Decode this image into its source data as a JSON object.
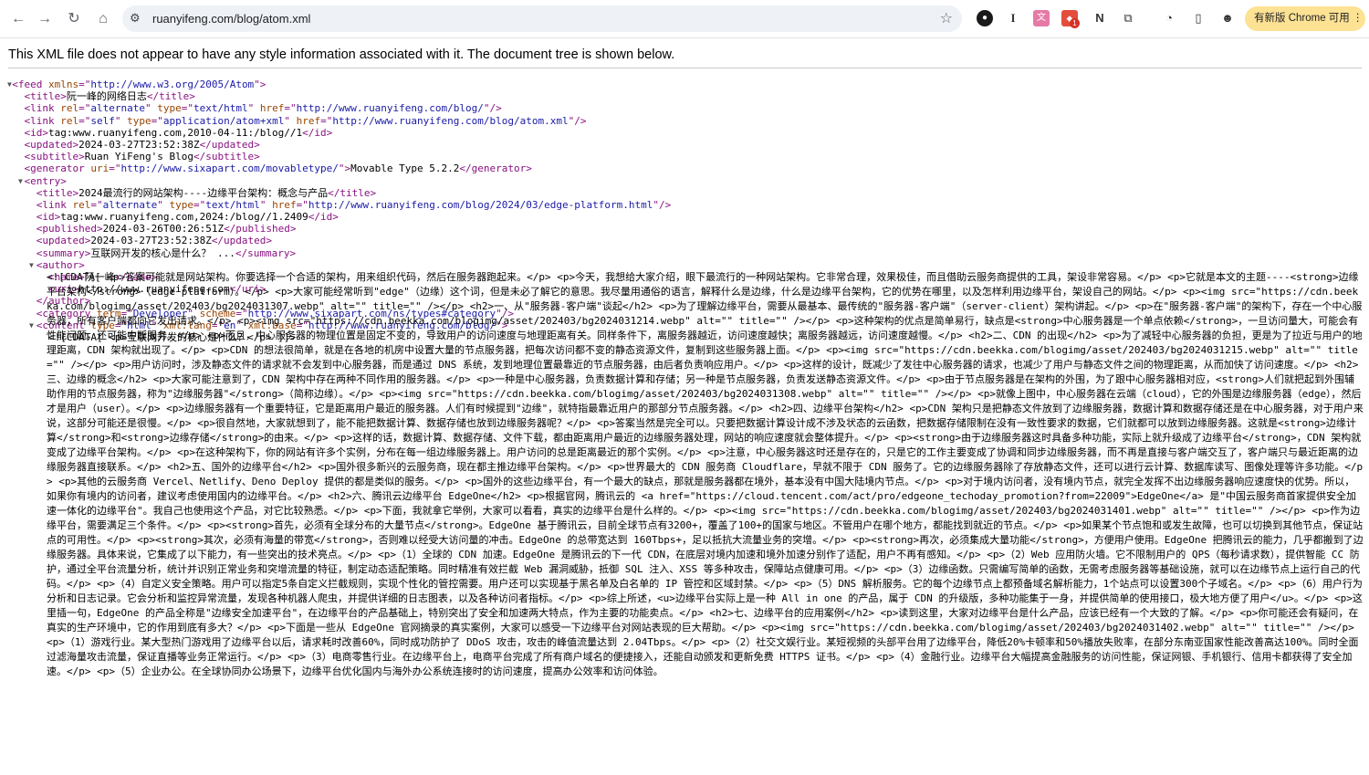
{
  "browser": {
    "url": "ruanyifeng.com/blog/atom.xml",
    "update_label": "有新版 Chrome 可用",
    "ext_badge": "1"
  },
  "banner": "This XML file does not appear to have any style information associated with it. The document tree is shown below.",
  "xml": {
    "feed_open": "<feed xmlns=\"http://www.w3.org/2005/Atom\">",
    "title": "阮一峰的网络日志",
    "link_alt_href": "http://www.ruanyifeng.com/blog/",
    "link_self_href": "http://www.ruanyifeng.com/blog/atom.xml",
    "id": "tag:www.ruanyifeng.com,2010-04-11:/blog//1",
    "updated": "2024-03-27T23:52:38Z",
    "subtitle": "Ruan YiFeng's Blog",
    "generator_uri": "http://www.sixapart.com/movabletype/",
    "generator": "Movable Type 5.2.2",
    "entry": {
      "title": "2024最流行的网站架构----边缘平台架构：概念与产品",
      "link_href": "http://www.ruanyifeng.com/blog/2024/03/edge-platform.html",
      "id": "tag:www.ruanyifeng.com,2024:/blog//1.2409",
      "published": "2024-03-26T00:26:51Z",
      "updated": "2024-03-27T23:52:38Z",
      "summary": "互联网开发的核心是什么？ ...",
      "author_name": "阮一峰",
      "author_uri": "http://www.ruanyifeng.com",
      "category_term": "Developer",
      "category_scheme": "http://www.sixapart.com/ns/types#category",
      "content_base": "http://www.ruanyifeng.com/blog/",
      "cdata_short": "<![CDATA[ <p>互联网开发的核心是什么？</p> ]]>",
      "cdata_long": "<![CDATA[ <p>答案可能就是网站架构。你要选择一个合适的架构，用来组织代码，然后在服务器跑起来。</p> <p>今天，我想给大家介绍，眼下最流行的一种网站架构。它非常合理，效果极佳，而且借助云服务商提供的工具，架设非常容易。</p> <p>它就是本文的主题----<strong>边缘平台架构</strong>（edge platform）。</p> <p>大家可能经常听到\"edge\"（边缘）这个词，但是未必了解它的意思。我尽量用通俗的语言，解释什么是边缘，什么是边缘平台架构，它的优势在哪里，以及怎样利用边缘平台，架设自己的网站。</p> <p><img src=\"https://cdn.beekka.com/blogimg/asset/202403/bg2024031307.webp\" alt=\"\" title=\"\" /></p> <h2>一、从\"服务器-客户端\"谈起</h2> <p>为了理解边缘平台，需要从最基本、最传统的\"服务器-客户端\"（server-client）架构讲起。</p> <p>在\"服务器-客户端\"的架构下，存在一个中心服务器，所有客户端都向它发出请求。</p> <p><img src=\"https://cdn.beekka.com/blogimg/asset/202403/bg2024031214.webp\" alt=\"\" title=\"\" /></p> <p>这种架构的优点是简单易行，缺点是<strong>中心服务器是一个单点依赖</strong>，一旦访问量大，可能会有性能问题，还可能中断服务。</p> <p>而且，中心服务器的物理位置是固定不变的，导致用户的访问速度与地理距离有关。同样条件下，离服务器越近，访问速度越快；离服务器越远，访问速度越慢。</p> <h2>二、CDN 的出现</h2> <p>为了减轻中心服务器的负担，更是为了拉近与用户的地理距离，CDN 架构就出现了。</p> <p>CDN 的想法很简单，就是在各地的机房中设置大量的节点服务器，把每次访问都不变的静态资源文件，复制到这些服务器上面。</p> <p><img src=\"https://cdn.beekka.com/blogimg/asset/202403/bg2024031215.webp\" alt=\"\" title=\"\" /></p> <p>用户访问时，涉及静态文件的请求就不会发到中心服务器，而是通过 DNS 系统，发到地理位置最靠近的节点服务器，由后者负责响应用户。</p> <p>这样的设计，既减少了发往中心服务器的请求，也减少了用户与静态文件之间的物理距离，从而加快了访问速度。</p> <h2>三、边缘的概念</h2> <p>大家可能注意到了，CDN 架构中存在两种不同作用的服务器。</p> <p>一种是中心服务器，负责数据计算和存储；另一种是节点服务器，负责发送静态资源文件。</p> <p>由于节点服务器是在架构的外围，为了跟中心服务器相对应，<strong>人们就把起到外围辅助作用的节点服务器，称为\"边缘服务器\"</strong>（简称边缘）。</p> <p><img src=\"https://cdn.beekka.com/blogimg/asset/202403/bg2024031308.webp\" alt=\"\" title=\"\" /></p> <p>就像上图中，中心服务器在云端（cloud），它的外围是边缘服务器（edge），然后才是用户（user）。</p> <p>边缘服务器有一个重要特征，它是距离用户最近的服务器。人们有时候提到\"边缘\"，就特指最靠近用户的那部分节点服务器。</p> <h2>四、边缘平台架构</h2> <p>CDN 架构只是把静态文件放到了边缘服务器，数据计算和数据存储还是在中心服务器，对于用户来说，这部分可能还是很慢。</p> <p>很自然地，大家就想到了，能不能把数据计算、数据存储也放到边缘服务器呢？</p> <p>答案当然是完全可以。只要把数据计算设计成不涉及状态的云函数，把数据存储限制在没有一致性要求的数据，它们就都可以放到边缘服务器。这就是<strong>边缘计算</strong>和<strong>边缘存储</strong>的由来。</p> <p>这样的话，数据计算、数据存储、文件下载，都由距离用户最近的边缘服务器处理，网站的响应速度就会整体提升。</p> <p><strong>由于边缘服务器这时具备多种功能，实际上就升级成了边缘平台</strong>，CDN 架构就变成了边缘平台架构。</p> <p>在这种架构下，你的网站有许多个实例，分布在每一组边缘服务器上。用户访问的总是距离最近的那个实例。</p> <p>注意，中心服务器这时还是存在的，只是它的工作主要变成了协调和同步边缘服务器，而不再是直接与客户端交互了，客户端只与最近距离的边缘服务器直接联系。</p> <h2>五、国外的边缘平台</h2> <p>国外很多新兴的云服务商，现在都主推边缘平台架构。</p> <p>世界最大的 CDN 服务商 Cloudflare，早就不限于 CDN 服务了。它的边缘服务器除了存放静态文件，还可以进行云计算、数据库读写、图像处理等许多功能。</p> <p>其他的云服务商 Vercel、Netlify、Deno Deploy 提供的都是类似的服务。</p> <p>国外的这些边缘平台，有一个最大的缺点，那就是服务器都在境外，基本没有中国大陆境内节点。</p> <p>对于境内访问者，没有境内节点，就完全发挥不出边缘服务器响应速度快的优势。所以，如果你有境内的访问者，建议考虑使用国内的边缘平台。</p> <h2>六、腾讯云边缘平台 EdgeOne</h2> <p>根据官网，腾讯云的 <a href=\"https://cloud.tencent.com/act/pro/edgeone_techoday_promotion?from=22009\">EdgeOne</a> 是\"中国云服务商首家提供安全加速一体化的边缘平台\"。我自己也使用这个产品，对它比较熟悉。</p> <p>下面，我就拿它举例，大家可以看看，真实的边缘平台是什么样的。</p> <p><img src=\"https://cdn.beekka.com/blogimg/asset/202403/bg2024031401.webp\" alt=\"\" title=\"\" /></p> <p>作为边缘平台，需要满足三个条件。</p> <p><strong>首先，必须有全球分布的大量节点</strong>。EdgeOne 基于腾讯云，目前全球节点有3200+，覆盖了100+的国家与地区。不管用户在哪个地方，都能找到就近的节点。</p> <p>如果某个节点饱和或发生故障，也可以切换到其他节点，保证站点的可用性。</p> <p><strong>其次，必须有海量的带宽</strong>，否则难以经受大访问量的冲击。EdgeOne 的总带宽达到 160Tbps+，足以抵抗大流量业务的突增。</p> <p><strong>再次，必须集成大量功能</strong>，方便用户使用。EdgeOne 把腾讯云的能力，几乎都搬到了边缘服务器。具体来说，它集成了以下能力，有一些突出的技术亮点。</p> <p>（1）全球的 CDN 加速。EdgeOne 是腾讯云的下一代 CDN，在底层对境内加速和境外加速分别作了适配，用户不再有感知。</p> <p>（2）Web 应用防火墙。它不限制用户的 QPS（每秒请求数），提供智能 CC 防护，通过全平台流量分析，统计并识别正常业务和突增流量的特征，制定动态适配策略。同时精准有效拦截 Web 漏洞威胁，抵御 SQL 注入、XSS 等多种攻击，保障站点健康可用。</p> <p>（3）边缘函数。只需编写简单的函数，无需考虑服务器等基础设施，就可以在边缘节点上运行自己的代码。</p> <p>（4）自定义安全策略。用户可以指定5条自定义拦截规则，实现个性化的管控需要。用户还可以实现基于黑名单及白名单的 IP 管控和区域封禁。</p> <p>（5）DNS 解析服务。它的每个边缘节点上都预备域名解析能力，1个站点可以设置300个子域名。</p> <p>（6）用户行为分析和日志记录。它会分析和监控异常流量，发现各种机器人爬虫，并提供详细的日志图表，以及各种访问者指标。</p> <p>综上所述，<u>边缘平台实际上是一种 All in one 的产品，属于 CDN 的升级版，多种功能集于一身，并提供简单的使用接口，极大地方便了用户</u>。</p> <p>这里插一句，EdgeOne 的产品全称是\"边缘安全加速平台\"，在边缘平台的产品基础上，特别突出了安全和加速两大特点，作为主要的功能卖点。</p> <h2>七、边缘平台的应用案例</h2> <p>读到这里，大家对边缘平台是什么产品，应该已经有一个大致的了解。</p> <p>你可能还会有疑问，在真实的生产环境中，它的作用到底有多大？</p> <p>下面是一些从 EdgeOne 官网摘录的真实案例，大家可以感受一下边缘平台对网站表现的巨大帮助。</p> <p><img src=\"https://cdn.beekka.com/blogimg/asset/202403/bg2024031402.webp\" alt=\"\" title=\"\" /></p> <p>（1）游戏行业。某大型热门游戏用了边缘平台以后，请求耗时改善60%，同时成功防护了 DDoS 攻击，攻击的峰值流量达到 2.04Tbps。</p> <p>（2）社交文娱行业。某短视频的头部平台用了边缘平台，降低20%卡顿率和50%播放失败率，在部分东南亚国家性能改善高达100%。同时全面过滤海量攻击流量，保证直播等业务正常运行。</p> <p>（3）电商零售行业。在边缘平台上，电商平台完成了所有商户域名的便捷接入，还能自动颁发和更新免费 HTTPS 证书。</p> <p>（4）金融行业。边缘平台大幅提高金融服务的访问性能，保证网银、手机银行、信用卡都获得了安全加速。</p> <p>（5）企业办公。在全球协同办公场景下，边缘平台优化国内与海外办公系统连接时的访问速度，提高办公效率和访问体验。"
    }
  }
}
